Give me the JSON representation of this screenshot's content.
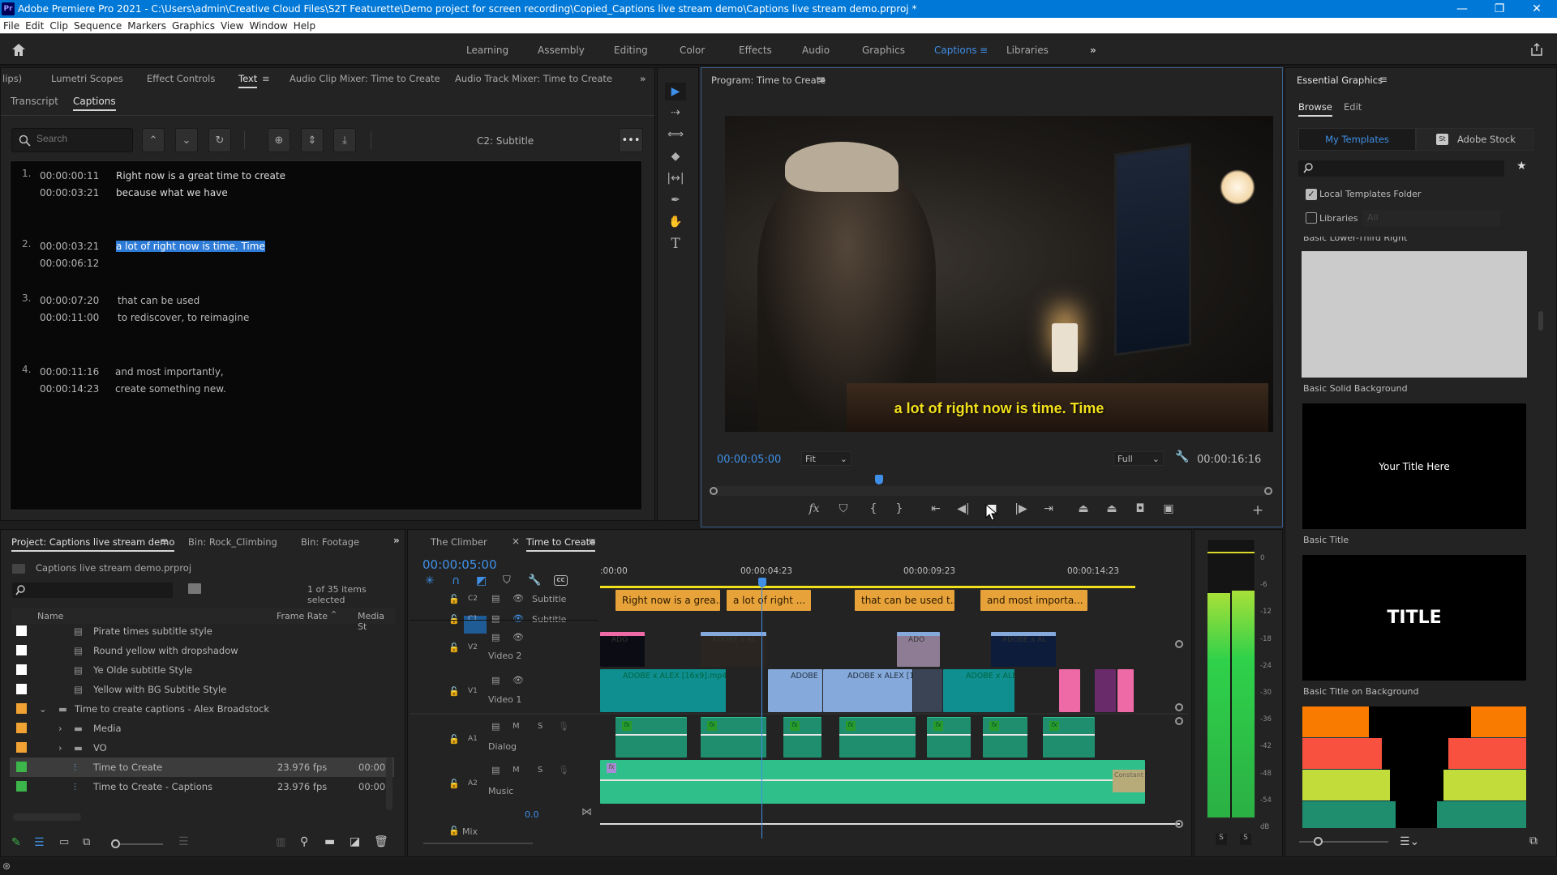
{
  "window": {
    "app_icon": "Pr",
    "title": "Adobe Premiere Pro 2021 - C:\\Users\\admin\\Creative Cloud Files\\S2T Featurette\\Demo project for screen recording\\Copied_Captions live stream demo\\Captions live stream demo.prproj *",
    "controls": {
      "minimize": "—",
      "restore": "❐",
      "close": "✕"
    }
  },
  "menu": [
    "File",
    "Edit",
    "Clip",
    "Sequence",
    "Markers",
    "Graphics",
    "View",
    "Window",
    "Help"
  ],
  "workspaces": {
    "tabs": [
      "Learning",
      "Assembly",
      "Editing",
      "Color",
      "Effects",
      "Audio",
      "Graphics",
      "Captions",
      "Libraries"
    ],
    "active": "Captions",
    "overflow": "»",
    "home_icon": "home-icon",
    "share_icon": "share-icon"
  },
  "text_panel": {
    "tabs": [
      "lips)",
      "Lumetri Scopes",
      "Effect Controls",
      "Text",
      "Audio Clip Mixer: Time to Create",
      "Audio Track Mixer: Time to Create"
    ],
    "active_tab": "Text",
    "overflow": "»",
    "subtabs": [
      "Transcript",
      "Captions"
    ],
    "active_subtab": "Captions",
    "search_placeholder": "Search",
    "track_label": "C2: Subtitle",
    "more": "•••",
    "captions": [
      {
        "num": "1.",
        "in": "00:00:00:11",
        "out": "00:00:03:21",
        "lines": [
          "Right now is a great time to create",
          "because what we have"
        ],
        "selected": false
      },
      {
        "num": "2.",
        "in": "00:00:03:21",
        "out": "00:00:06:12",
        "lines": [
          "a lot of right now is time. Time"
        ],
        "selected": true
      },
      {
        "num": "3.",
        "in": "00:00:07:20",
        "out": "00:00:11:00",
        "lines": [
          "that can be used",
          "to rediscover, to reimagine"
        ],
        "selected": false
      },
      {
        "num": "4.",
        "in": "00:00:11:16",
        "out": "00:00:14:23",
        "lines": [
          "and most importantly,",
          "create something new."
        ],
        "selected": false
      }
    ]
  },
  "tools": [
    "selection-tool",
    "track-select-tool",
    "ripple-edit-tool",
    "razor-tool",
    "slip-tool",
    "pen-tool",
    "hand-tool",
    "type-tool"
  ],
  "program_monitor": {
    "title": "Program: Time to Create",
    "caption_overlay": "a lot of right now is time. Time",
    "current_time": "00:00:05:00",
    "zoom": "Fit",
    "resolution": "Full",
    "duration": "00:00:16:16",
    "playhead_fraction": 0.3,
    "transport": [
      "fx",
      "marker",
      "in",
      "out",
      "go-to-in",
      "step-back",
      "stop",
      "step-forward",
      "go-to-out",
      "lift",
      "extract",
      "export-frame",
      "comparison"
    ],
    "add": "+"
  },
  "essential_graphics": {
    "title": "Essential Graphics",
    "tabs": [
      "Browse",
      "Edit"
    ],
    "active_tab": "Browse",
    "sources": [
      "My Templates",
      "Adobe Stock"
    ],
    "active_source": "My Templates",
    "stock_badge": "St",
    "local_templates_label": "Local Templates Folder",
    "local_templates_checked": true,
    "libraries_label": "Libraries",
    "libraries_checked": false,
    "libraries_value": "All",
    "templates": [
      {
        "name": "Basic Lower-Third Right",
        "preview_text": ""
      },
      {
        "name": "Basic Solid Background",
        "preview_text": ""
      },
      {
        "name": "Basic Title",
        "preview_text": "Your Title Here"
      },
      {
        "name": "Basic Title on Background",
        "preview_text": "TITLE"
      },
      {
        "name": "",
        "preview_text": ""
      }
    ]
  },
  "project_panel": {
    "tabs": [
      "Project: Captions live stream demo",
      "Bin: Rock_Climbing",
      "Bin: Footage"
    ],
    "active_tab": "Project: Captions live stream demo",
    "overflow": "»",
    "project_file": "Captions live stream demo.prproj",
    "search_value": "",
    "selection_count": "1 of 35 items selected",
    "columns": [
      "Name",
      "Frame Rate",
      "Media St"
    ],
    "rows": [
      {
        "name": "Pirate times subtitle style",
        "color": "#ffffff",
        "type": "graphic",
        "indent": 2,
        "frame_rate": "",
        "media_start": ""
      },
      {
        "name": "Round yellow with dropshadow",
        "color": "#ffffff",
        "type": "graphic",
        "indent": 2,
        "frame_rate": "",
        "media_start": ""
      },
      {
        "name": "Ye Olde subtitle Style",
        "color": "#ffffff",
        "type": "graphic",
        "indent": 2,
        "frame_rate": "",
        "media_start": ""
      },
      {
        "name": "Yellow with BG Subtitle Style",
        "color": "#ffffff",
        "type": "graphic",
        "indent": 2,
        "frame_rate": "",
        "media_start": ""
      },
      {
        "name": "Time to create captions - Alex Broadstock",
        "color": "#f0a232",
        "type": "folder-open",
        "indent": 1,
        "frame_rate": "",
        "media_start": ""
      },
      {
        "name": "Media",
        "color": "#f0a232",
        "type": "folder",
        "indent": 2,
        "frame_rate": "",
        "media_start": ""
      },
      {
        "name": "VO",
        "color": "#f0a232",
        "type": "folder",
        "indent": 2,
        "frame_rate": "",
        "media_start": ""
      },
      {
        "name": "Time to Create",
        "color": "#3cb54a",
        "type": "sequence",
        "indent": 2,
        "frame_rate": "23.976 fps",
        "media_start": "00:00:",
        "selected": true
      },
      {
        "name": "Time to Create - Captions",
        "color": "#3cb54a",
        "type": "sequence",
        "indent": 2,
        "frame_rate": "23.976 fps",
        "media_start": "00:00:"
      }
    ]
  },
  "timeline": {
    "tabs": [
      "The Climber",
      "Time to Create"
    ],
    "active_tab": "Time to Create",
    "close": "×",
    "timecode": "00:00:05:00",
    "ruler": [
      ":00:00",
      "00:00:04:23",
      "00:00:09:23",
      "00:00:14:23"
    ],
    "tracks": [
      {
        "id": "C2",
        "name": "Subtitle"
      },
      {
        "id": "C1",
        "name": "Subtitle"
      },
      {
        "id": "V2",
        "name": "Video 2"
      },
      {
        "id": "V1",
        "name": "Video 1"
      },
      {
        "id": "A1",
        "name": "Dialog",
        "m": "M",
        "s": "S"
      },
      {
        "id": "A2",
        "name": "Music",
        "m": "M",
        "s": "S"
      },
      {
        "id": "Mix",
        "name": "",
        "value": "0.0"
      }
    ],
    "caption_clips": [
      "Right now is a grea...",
      "a lot of right ...",
      "that can be used t...",
      "and most importa..."
    ],
    "v1_clips": [
      "ADOBE x ALEX [16x9].mp4",
      "ADOBE",
      "ADOBE x ALEX [16",
      "ADOBE x ALE"
    ],
    "v2_clips": [
      "ADO",
      "ADOBE x AL",
      "ADO",
      "ADOBE x AL"
    ],
    "music_end_clip": "Constant"
  },
  "audio_meter": {
    "scale": [
      "0",
      "-6",
      "-12",
      "-18",
      "-24",
      "-30",
      "-36",
      "-42",
      "-48",
      "-54",
      "dB"
    ],
    "left_level_db": -11.5,
    "right_level_db": -11,
    "solo": [
      "S",
      "S"
    ]
  },
  "colors": {
    "accent": "#3f8fe6",
    "caption_clip": "#e8a23a",
    "caption_text": "#f2e01c",
    "audio_clip": "#2fbf8a",
    "video_teal": "#0f8f8f",
    "video_blue": "#86a9db",
    "video_pink": "#ee6aa7"
  }
}
